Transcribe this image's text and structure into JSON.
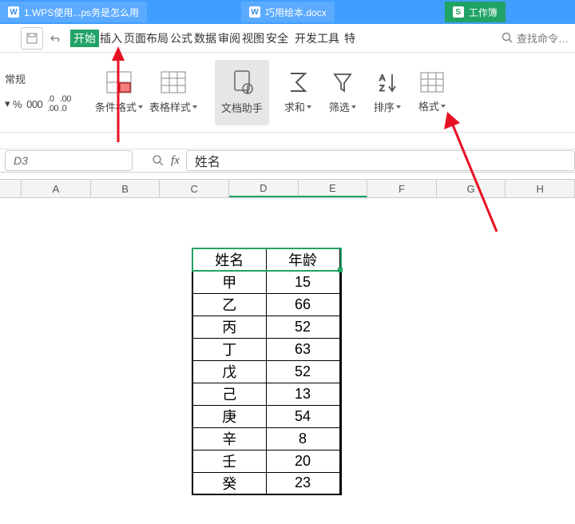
{
  "tabs": [
    {
      "icon": "W",
      "label": "1.WPS使用...ps务是怎么用"
    },
    {
      "icon": "W",
      "label": "巧用绘本.docx"
    },
    {
      "icon": "S",
      "label": "工作簿"
    }
  ],
  "menubar": {
    "start": "开始",
    "items": [
      "插入",
      "页面布局",
      "公式",
      "数据",
      "审阅",
      "视图",
      "安全",
      "开发工具",
      "特"
    ],
    "search": "查找命令…"
  },
  "ribbon": {
    "left_top": "常规",
    "left_btns": [
      "%",
      "000",
      ".0",
      ".00"
    ],
    "tools": [
      {
        "name": "conditional-format",
        "label": "条件格式"
      },
      {
        "name": "table-style",
        "label": "表格样式"
      },
      {
        "name": "doc-helper",
        "label": "文档助手"
      },
      {
        "name": "sum",
        "label": "求和"
      },
      {
        "name": "filter",
        "label": "筛选"
      },
      {
        "name": "sort",
        "label": "排序"
      },
      {
        "name": "format",
        "label": "格式"
      }
    ]
  },
  "namebox": "D3",
  "formula": "姓名",
  "columns": [
    "A",
    "B",
    "C",
    "D",
    "E",
    "F",
    "G",
    "H"
  ],
  "table": {
    "headers": [
      "姓名",
      "年龄"
    ],
    "rows": [
      [
        "甲",
        "15"
      ],
      [
        "乙",
        "66"
      ],
      [
        "丙",
        "52"
      ],
      [
        "丁",
        "63"
      ],
      [
        "戊",
        "52"
      ],
      [
        "己",
        "13"
      ],
      [
        "庚",
        "54"
      ],
      [
        "辛",
        "8"
      ],
      [
        "壬",
        "20"
      ],
      [
        "癸",
        "23"
      ]
    ]
  }
}
